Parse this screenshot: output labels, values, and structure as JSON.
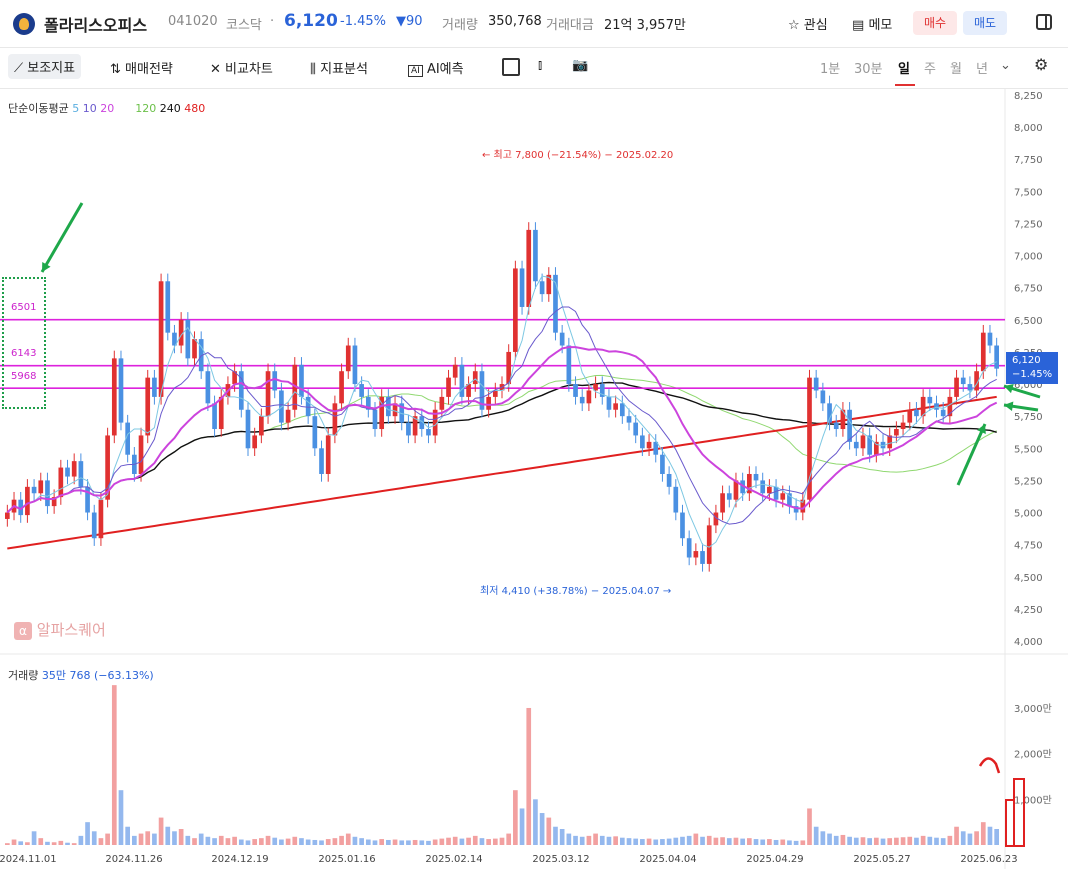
{
  "header": {
    "name": "폴라리스오피스",
    "code": "041020",
    "market": "코스닥",
    "dot": "·",
    "price": "6,120",
    "change_pct": "-1.45%",
    "change_abs": "▼90",
    "vol_label": "거래량",
    "vol_value": "350,768",
    "amt_label": "거래대금",
    "amt_value": "21억 3,957만",
    "watch": "관심",
    "memo": "메모",
    "buy": "매수",
    "sell": "매도"
  },
  "toolbar": {
    "aux": "보조지표",
    "strategy": "매매전략",
    "compare": "비교차트",
    "analysis": "지표분석",
    "ai": "AI예측",
    "periods": [
      "1분",
      "30분",
      "일",
      "주",
      "월",
      "년"
    ],
    "active_period": "일"
  },
  "ma_legend": {
    "label": "단순이동평균",
    "p5": "5",
    "p10": "10",
    "p20": "20",
    "p120": "120",
    "p240": "240",
    "p480": "480"
  },
  "watermark": "알파스퀘어",
  "annotations": {
    "high": "← 최고 7,800 (−21.54%) − 2025.02.20",
    "low": "최저 4,410 (+38.78%) − 2025.04.07 →"
  },
  "level_labels": [
    "6501",
    "6143",
    "5968"
  ],
  "price_tag": {
    "price": "6,120",
    "pct": "−1.45%"
  },
  "volume_label": {
    "title": "거래량",
    "value": "35만 768 (−63.13%)"
  },
  "chart_data": {
    "type": "candlestick",
    "y_axis": {
      "min": 4000,
      "max": 8250,
      "step": 250,
      "ticks": [
        "8,250",
        "8,000",
        "7,750",
        "7,500",
        "7,250",
        "7,000",
        "6,750",
        "6,500",
        "6,250",
        "6,000",
        "5,750",
        "5,500",
        "5,250",
        "5,000",
        "4,750",
        "4,500",
        "4,250",
        "4,000"
      ]
    },
    "x_ticks": [
      "2024.11.01",
      "2024.11.26",
      "2024.12.19",
      "2025.01.16",
      "2025.02.14",
      "2025.03.12",
      "2025.04.04",
      "2025.04.29",
      "2025.05.27",
      "2025.06.23"
    ],
    "horizontal_levels": [
      6501,
      6143,
      5968
    ],
    "close": [
      5000,
      5100,
      4980,
      5200,
      5150,
      5250,
      5050,
      5120,
      5350,
      5280,
      5400,
      5200,
      5000,
      4800,
      5100,
      5600,
      6200,
      5700,
      5450,
      5300,
      5600,
      6050,
      5900,
      6800,
      6400,
      6300,
      6500,
      6200,
      6350,
      6100,
      5850,
      5650,
      5900,
      6000,
      6100,
      5800,
      5500,
      5600,
      5750,
      6100,
      5950,
      5700,
      5800,
      6150,
      5900,
      5750,
      5500,
      5300,
      5600,
      5850,
      6100,
      6300,
      6000,
      5900,
      5800,
      5650,
      5900,
      5750,
      5850,
      5700,
      5600,
      5750,
      5650,
      5600,
      5800,
      5900,
      6050,
      6150,
      5900,
      6000,
      6100,
      5800,
      5900,
      5950,
      6000,
      6250,
      6900,
      6600,
      7200,
      6800,
      6700,
      6850,
      6400,
      6300,
      6000,
      5900,
      5850,
      5950,
      6000,
      5900,
      5800,
      5850,
      5750,
      5700,
      5600,
      5500,
      5550,
      5450,
      5300,
      5200,
      5000,
      4800,
      4650,
      4700,
      4600,
      4900,
      5000,
      5150,
      5100,
      5250,
      5150,
      5300,
      5250,
      5150,
      5200,
      5100,
      5150,
      5050,
      5000,
      5100,
      6050,
      5950,
      5850,
      5700,
      5650,
      5800,
      5550,
      5500,
      5600,
      5450,
      5550,
      5500,
      5600,
      5650,
      5700,
      5800,
      5750,
      5900,
      5850,
      5800,
      5750,
      5900,
      6050,
      6000,
      5950,
      6100,
      6400,
      6300,
      6120
    ],
    "volume_wan": [
      40,
      120,
      80,
      60,
      300,
      150,
      70,
      60,
      90,
      50,
      40,
      200,
      500,
      300,
      150,
      250,
      3500,
      1200,
      400,
      200,
      250,
      300,
      250,
      600,
      400,
      300,
      350,
      200,
      150,
      250,
      180,
      150,
      200,
      150,
      180,
      120,
      100,
      130,
      150,
      200,
      160,
      120,
      140,
      180,
      150,
      120,
      110,
      100,
      130,
      150,
      200,
      250,
      180,
      150,
      120,
      100,
      130,
      110,
      120,
      100,
      100,
      110,
      100,
      90,
      120,
      140,
      160,
      180,
      140,
      160,
      200,
      150,
      130,
      140,
      160,
      250,
      1200,
      800,
      3000,
      1000,
      700,
      600,
      400,
      350,
      250,
      200,
      180,
      200,
      250,
      200,
      180,
      190,
      160,
      150,
      140,
      130,
      140,
      120,
      130,
      140,
      160,
      180,
      200,
      250,
      180,
      200,
      160,
      170,
      150,
      160,
      140,
      150,
      130,
      120,
      130,
      110,
      120,
      100,
      90,
      100,
      800,
      400,
      300,
      250,
      200,
      220,
      180,
      160,
      170,
      150,
      160,
      140,
      150,
      160,
      170,
      180,
      160,
      200,
      180,
      160,
      150,
      200,
      400,
      300,
      250,
      300,
      500,
      400,
      350
    ],
    "ma_colors": {
      "ma5": "#7ec8e3",
      "ma10": "#6a5acd",
      "ma20": "#cc44dd",
      "ma120": "#90d870",
      "ma240": "#111111",
      "ma480": "#e02020"
    },
    "up_color": "#e03131",
    "down_color": "#4a90e2",
    "volume_axis_ticks": [
      "3,000만",
      "2,000만",
      "1,000만"
    ]
  }
}
